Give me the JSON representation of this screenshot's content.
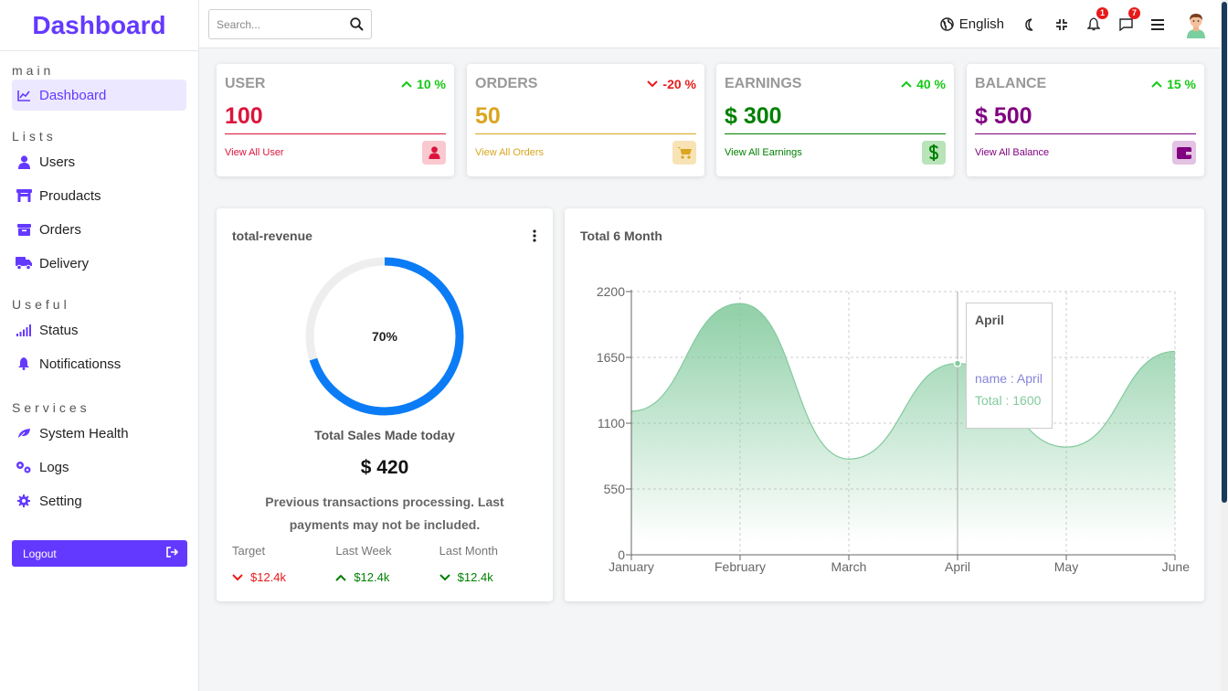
{
  "sidebar": {
    "brand": "Dashboard",
    "sections": [
      {
        "title": "main",
        "items": [
          {
            "label": "Dashboard",
            "icon": "line-chart-icon",
            "active": true
          }
        ]
      },
      {
        "title": "Lists",
        "items": [
          {
            "label": "Users",
            "icon": "user-icon"
          },
          {
            "label": "Proudacts",
            "icon": "store-icon"
          },
          {
            "label": "Orders",
            "icon": "box-icon"
          },
          {
            "label": "Delivery",
            "icon": "truck-icon"
          }
        ]
      },
      {
        "title": "Useful",
        "items": [
          {
            "label": "Status",
            "icon": "signal-icon"
          },
          {
            "label": "Notificationss",
            "icon": "bell-icon"
          }
        ]
      },
      {
        "title": "Services",
        "items": [
          {
            "label": "System Health",
            "icon": "leaf-icon"
          },
          {
            "label": "Logs",
            "icon": "cogs-icon"
          },
          {
            "label": "Setting",
            "icon": "gear-icon"
          }
        ]
      }
    ],
    "logout": "Logout"
  },
  "topbar": {
    "search_placeholder": "Search...",
    "language": "English",
    "notifications_count": "1",
    "messages_count": "7"
  },
  "widgets": [
    {
      "title": "USER",
      "percent": "10 %",
      "trend": "up",
      "value": "100",
      "link": "View All User",
      "color": "#dc143c",
      "icon": "user-icon",
      "icon_bg": "#f9c9cf",
      "icon_color": "#dc143c"
    },
    {
      "title": "ORDERS",
      "percent": "-20 %",
      "trend": "down",
      "value": "50",
      "link": "View All Orders",
      "color": "#daa520",
      "icon": "cart-icon",
      "icon_bg": "#f7e3b5",
      "icon_color": "#daa520"
    },
    {
      "title": "EARNINGS",
      "percent": "40 %",
      "trend": "up",
      "value": "$ 300",
      "link": "View All Earnings",
      "color": "#008000",
      "icon": "dollar-icon",
      "icon_bg": "#b9e3b9",
      "icon_color": "#008000"
    },
    {
      "title": "BALANCE",
      "percent": "15 %",
      "trend": "up",
      "value": "$ 500",
      "link": "View All Balance",
      "color": "#800080",
      "icon": "wallet-icon",
      "icon_bg": "#e3c2e3",
      "icon_color": "#800080"
    }
  ],
  "revenue": {
    "title": "total-revenue",
    "progress_value": 70,
    "progress_label": "70%",
    "subtitle": "Total Sales Made today",
    "amount": "$ 420",
    "description": "Previous transactions processing. Last payments may not be included.",
    "stats": [
      {
        "label": "Target",
        "value": "$12.4k",
        "trend": "down",
        "color": "#e81a1a"
      },
      {
        "label": "Last Week",
        "value": "$12.4k",
        "trend": "up",
        "color": "#008000"
      },
      {
        "label": "Last Month",
        "value": "$12.4k",
        "trend": "down",
        "color": "#008000"
      }
    ]
  },
  "chart_data": {
    "type": "area",
    "title": "Total 6 Month",
    "categories": [
      "January",
      "February",
      "March",
      "April",
      "May",
      "June"
    ],
    "series": [
      {
        "name": "Total",
        "values": [
          1200,
          2100,
          800,
          1600,
          900,
          1700
        ]
      }
    ],
    "yticks": [
      0,
      550,
      1100,
      1650,
      2200
    ],
    "ylim": [
      0,
      2200
    ],
    "grid": true,
    "colors": {
      "line": "#82ca9d",
      "fill": "#82ca9d"
    },
    "tooltip": {
      "category": "April",
      "name_label": "name : April",
      "value_label": "Total : 1600"
    }
  }
}
